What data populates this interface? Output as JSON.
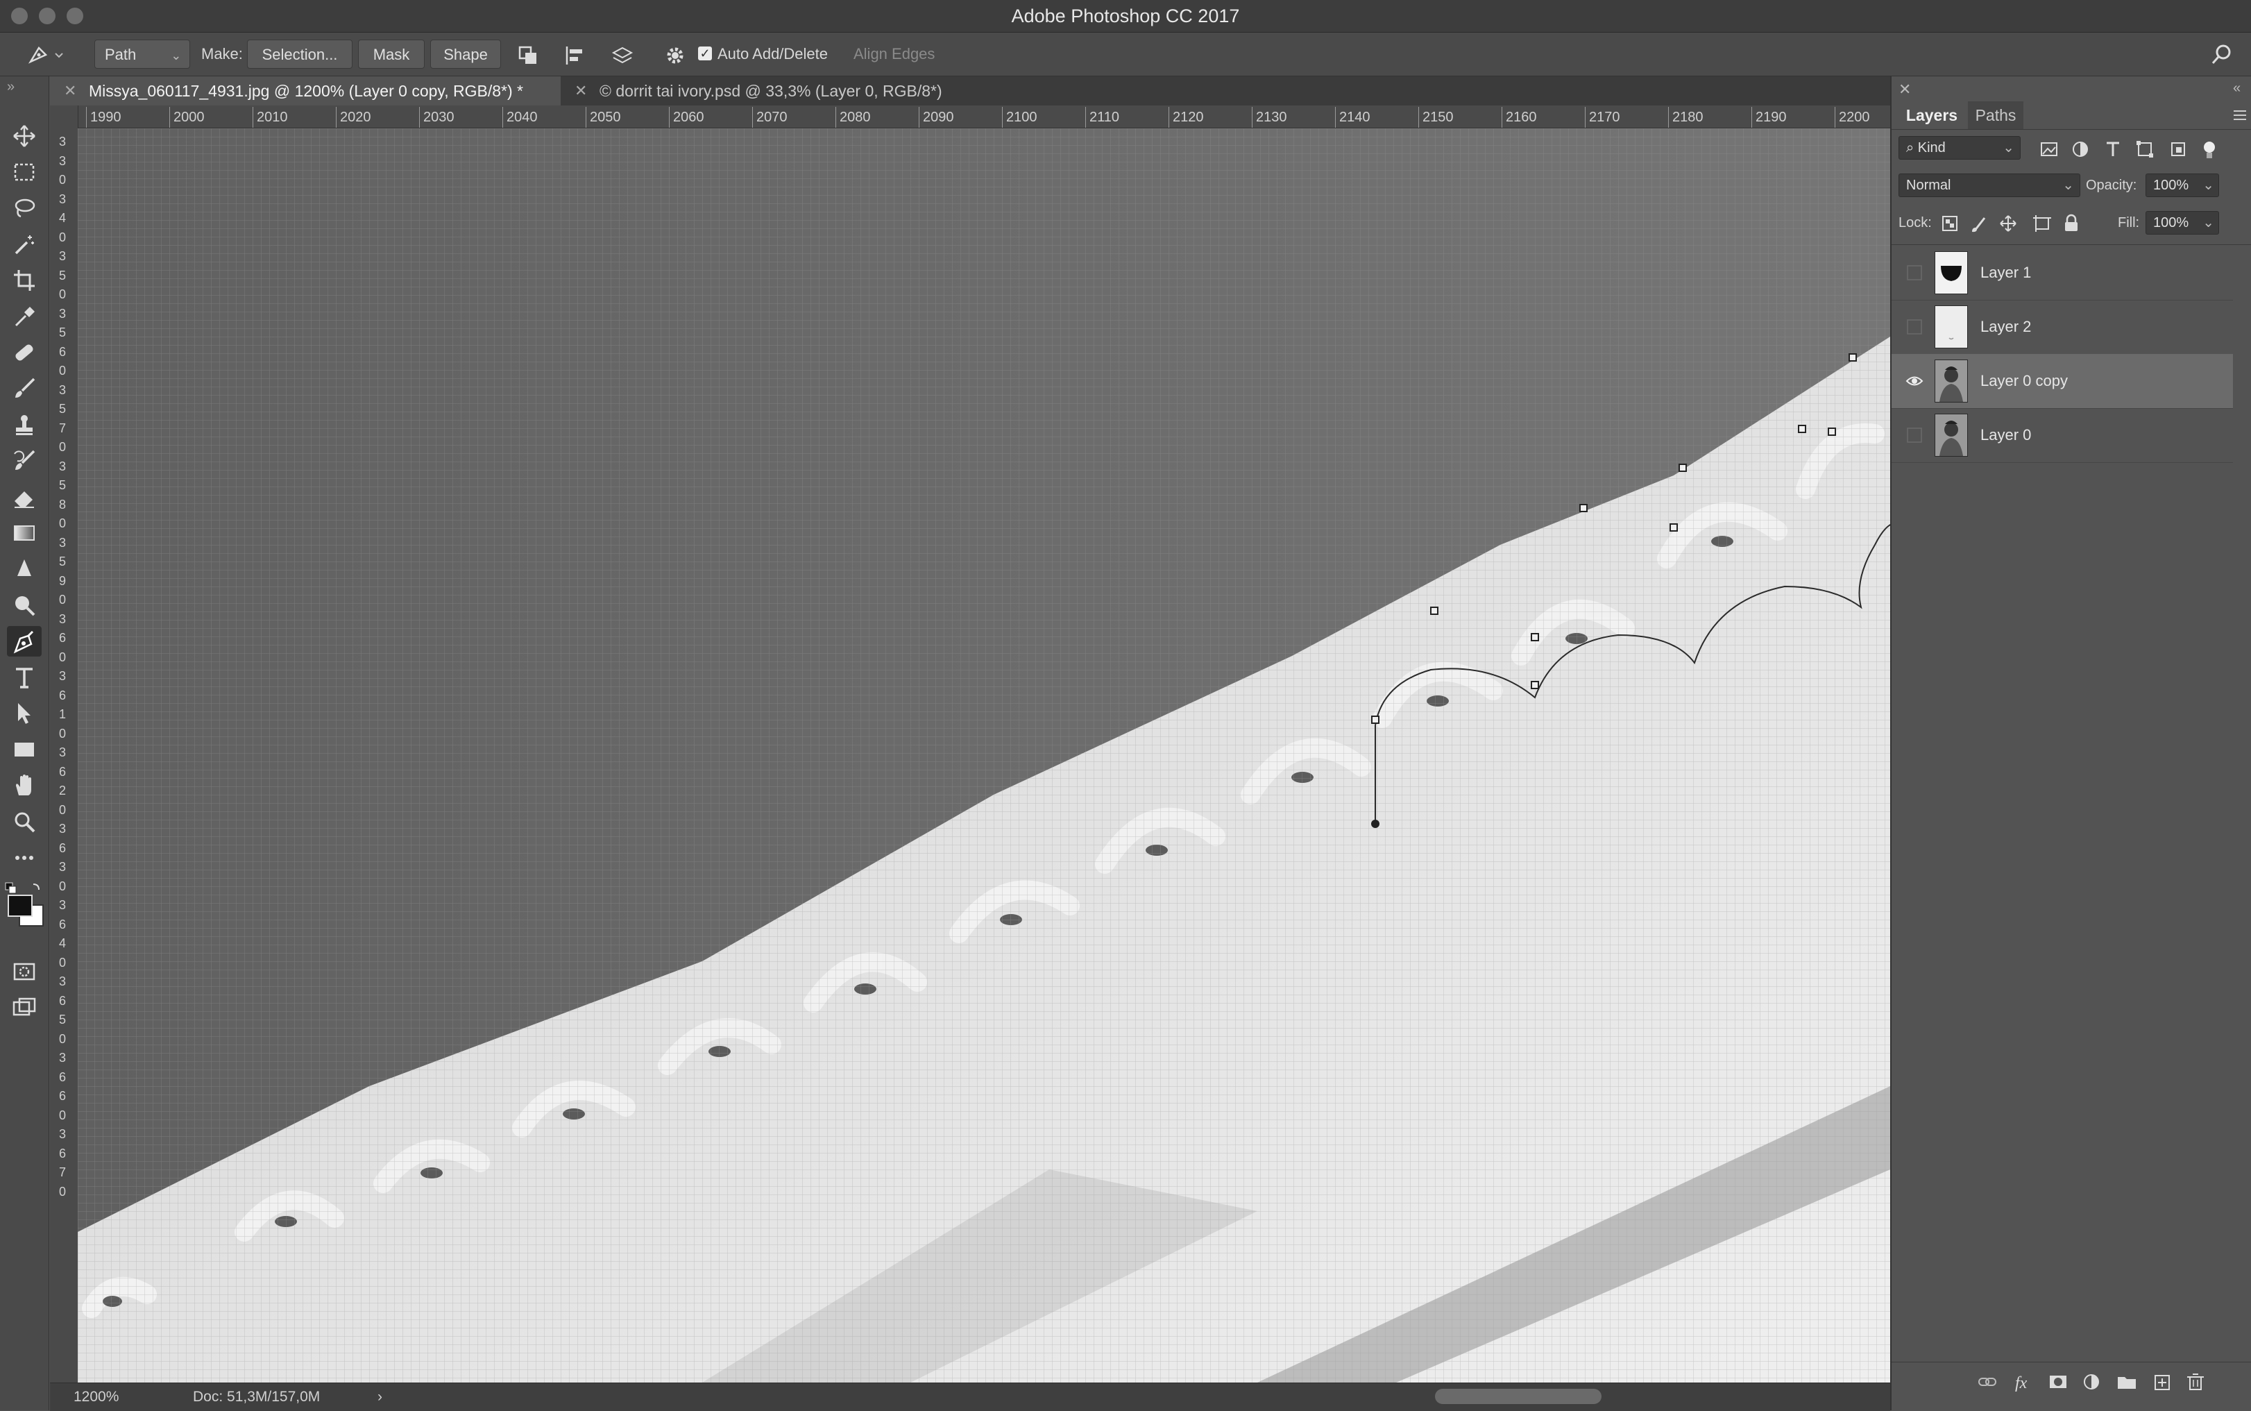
{
  "window": {
    "title": "Adobe Photoshop CC 2017"
  },
  "options_bar": {
    "mode_value": "Path",
    "make_label": "Make:",
    "selection_button": "Selection...",
    "mask_button": "Mask",
    "shape_button": "Shape",
    "auto_add_delete_label": "Auto Add/Delete",
    "auto_add_delete_checked": true,
    "align_edges_label": "Align Edges"
  },
  "document_tabs": [
    {
      "label": "Missya_060117_4931.jpg @ 1200% (Layer 0 copy, RGB/8*) *",
      "active": true
    },
    {
      "label": "© dorrit tai ivory.psd @ 33,3% (Layer 0, RGB/8*)",
      "active": false
    }
  ],
  "ruler": {
    "horizontal": [
      "1990",
      "2000",
      "2010",
      "2020",
      "2030",
      "2040",
      "2050",
      "2060",
      "2070",
      "2080",
      "2090",
      "2100",
      "2110",
      "2120",
      "2130",
      "2140",
      "2150",
      "2160",
      "2170",
      "2180",
      "2190",
      "2200"
    ],
    "vertical": [
      "3",
      "3",
      "0",
      "3",
      "4",
      "0",
      "3",
      "5",
      "0",
      "3",
      "5",
      "6",
      "0",
      "3",
      "5",
      "7",
      "0",
      "3",
      "5",
      "8",
      "0",
      "3",
      "5",
      "9",
      "0",
      "3",
      "6",
      "0",
      "3",
      "6",
      "1",
      "0",
      "3",
      "6",
      "2",
      "0",
      "3",
      "6",
      "3",
      "0",
      "3",
      "6",
      "4",
      "0",
      "3",
      "6",
      "5",
      "0",
      "3",
      "6",
      "6",
      "0",
      "3",
      "6",
      "7",
      "0"
    ]
  },
  "status_bar": {
    "zoom": "1200%",
    "doc_info": "Doc: 51,3M/157,0M",
    "arrow": "›"
  },
  "layers_panel": {
    "tabs": [
      "Layers",
      "Paths"
    ],
    "active_tab": "Layers",
    "filter_kind": "Kind",
    "blend_mode": "Normal",
    "opacity_label": "Opacity:",
    "opacity_value": "100%",
    "lock_label": "Lock:",
    "fill_label": "Fill:",
    "fill_value": "100%",
    "layers": [
      {
        "name": "Layer 1",
        "visible": false,
        "selected": false,
        "thumb": "mask-icon"
      },
      {
        "name": "Layer 2",
        "visible": false,
        "selected": false,
        "thumb": "blank-icon"
      },
      {
        "name": "Layer 0 copy",
        "visible": true,
        "selected": true,
        "thumb": "photo-icon"
      },
      {
        "name": "Layer 0",
        "visible": false,
        "selected": false,
        "thumb": "photo-icon"
      }
    ]
  },
  "colors": {
    "background": "#535353",
    "panel": "#4a4a4a",
    "title_bar": "#3d3d3d",
    "selected_layer": "#6b6b6b",
    "anchor_points": "#222222"
  }
}
